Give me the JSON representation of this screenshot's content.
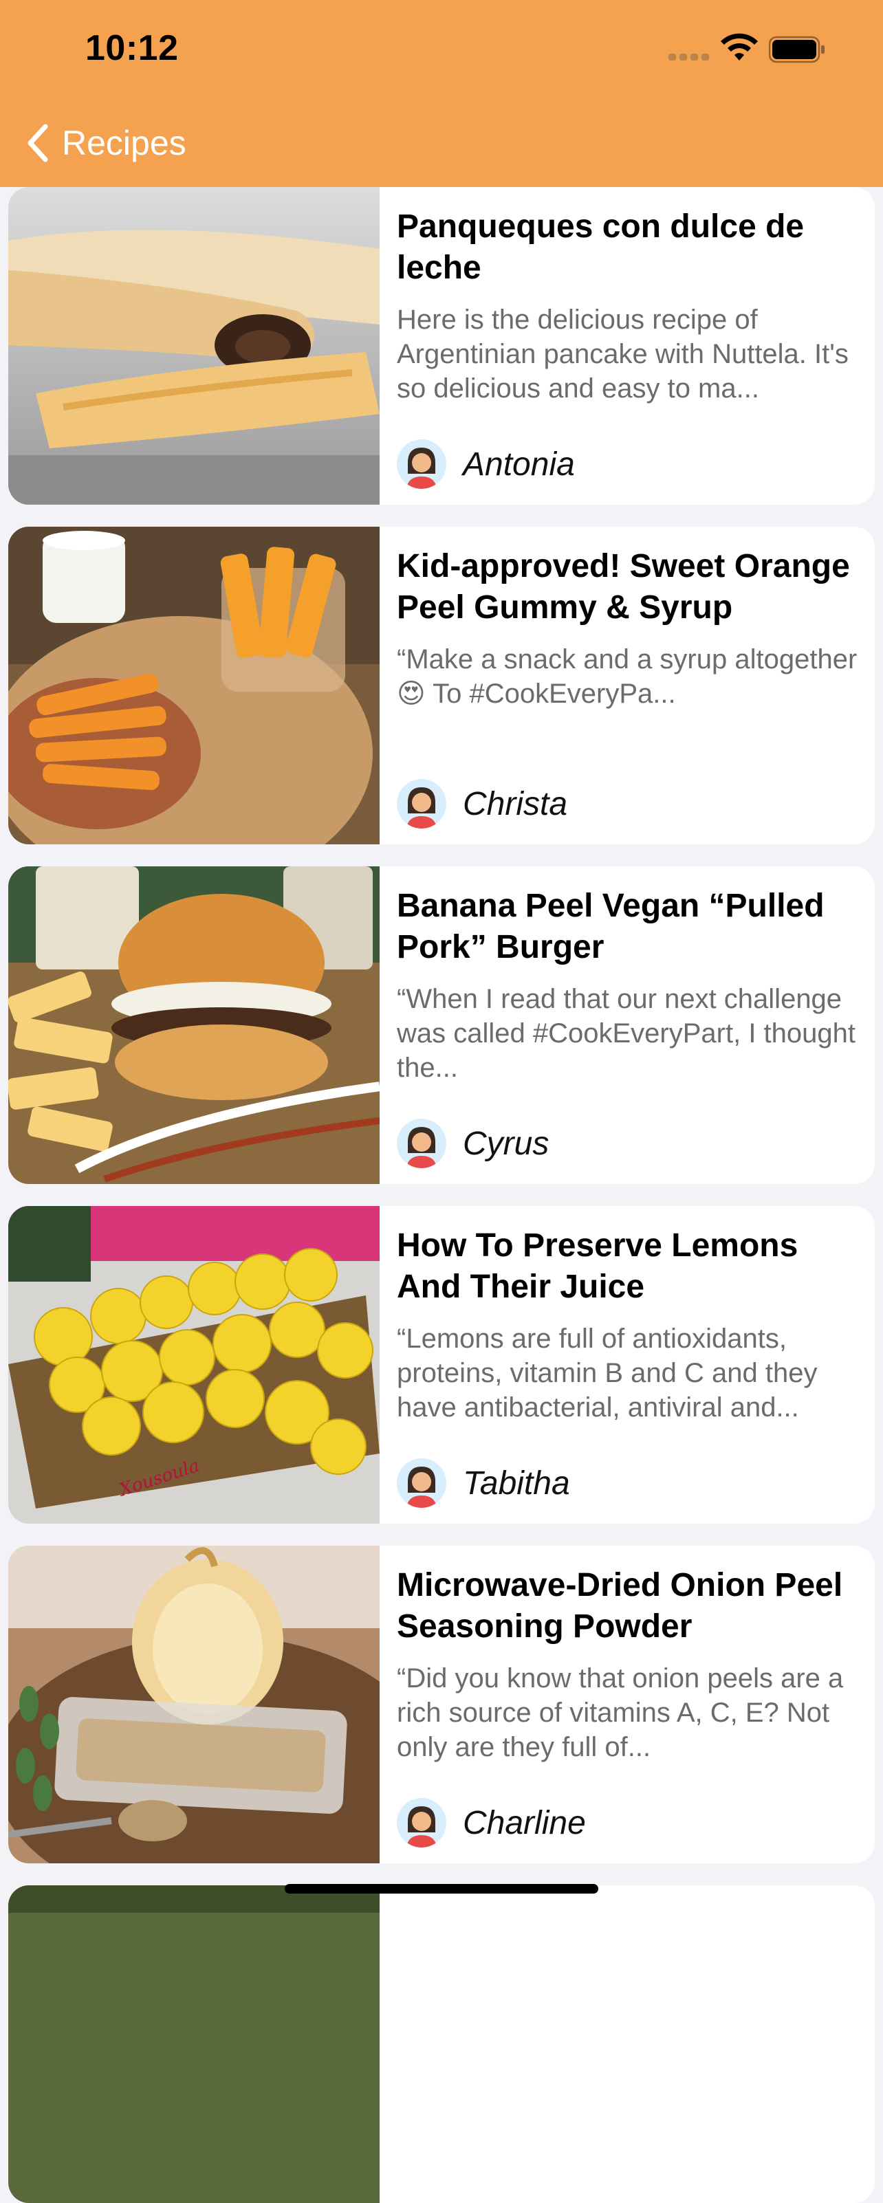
{
  "status_bar": {
    "time": "10:12"
  },
  "nav": {
    "back_label": "Recipes",
    "back_icon": "chevron-left-icon"
  },
  "colors": {
    "nav_background": "#f4a24f",
    "page_background": "#f2f2f7",
    "card_background": "#ffffff"
  },
  "recipes": [
    {
      "title": "Panqueques con dulce de leche",
      "description": "Here is the delicious recipe of Argentinian pancake with Nuttela. It's so delicious and easy to ma...",
      "author": "Antonia"
    },
    {
      "title": "Kid-approved! Sweet Orange Peel Gummy & Syrup",
      "description": "“Make a snack and a syrup altogether 😍 To #CookEveryPa...",
      "author": "Christa"
    },
    {
      "title": "Banana Peel Vegan “Pulled Pork” Burger",
      "description": "“When I read that our next challenge was called #CookEveryPart, I thought the...",
      "author": "Cyrus"
    },
    {
      "title": "How To Preserve Lemons And Their Juice",
      "description": "“Lemons are full of antioxidants, proteins, vitamin B and C and they have antibacterial, antiviral and...",
      "author": "Tabitha",
      "image_text": "Xousoula"
    },
    {
      "title": "Microwave-Dried Onion Peel Seasoning Powder",
      "description": "“Did you know that onion peels are a rich source of vitamins A, C, E? Not only are they full of...",
      "author": "Charline"
    }
  ]
}
